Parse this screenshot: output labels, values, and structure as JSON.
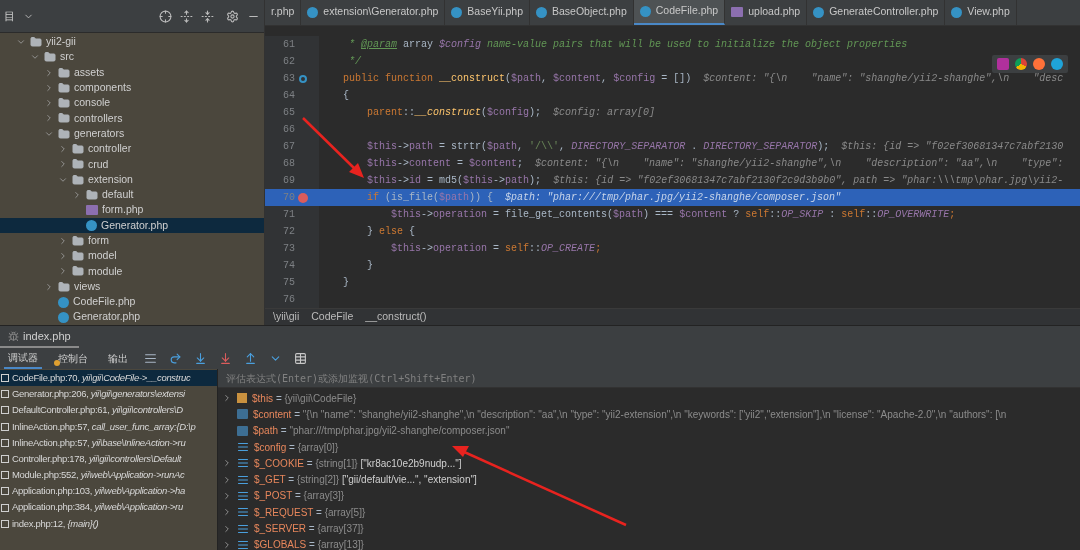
{
  "project": {
    "title": "目",
    "tree": [
      {
        "label": "yii2-gii",
        "kind": "folder",
        "expanded": true,
        "selected": false,
        "children": [
          {
            "label": "src",
            "kind": "folder",
            "expanded": true,
            "selected": false,
            "children": [
              {
                "label": "assets",
                "kind": "folder",
                "expanded": false,
                "selected": false
              },
              {
                "label": "components",
                "kind": "folder",
                "expanded": false,
                "selected": false
              },
              {
                "label": "console",
                "kind": "folder",
                "expanded": false,
                "selected": false
              },
              {
                "label": "controllers",
                "kind": "folder",
                "expanded": false,
                "selected": false
              },
              {
                "label": "generators",
                "kind": "folder",
                "expanded": true,
                "selected": false,
                "children": [
                  {
                    "label": "controller",
                    "kind": "folder",
                    "expanded": false,
                    "selected": false
                  },
                  {
                    "label": "crud",
                    "kind": "folder",
                    "expanded": false,
                    "selected": false
                  },
                  {
                    "label": "extension",
                    "kind": "folder",
                    "expanded": true,
                    "selected": false,
                    "children": [
                      {
                        "label": "default",
                        "kind": "folder",
                        "expanded": false,
                        "selected": false
                      },
                      {
                        "label": "form.php",
                        "kind": "php",
                        "selected": false
                      },
                      {
                        "label": "Generator.php",
                        "kind": "class",
                        "selected": true
                      }
                    ]
                  },
                  {
                    "label": "form",
                    "kind": "folder",
                    "expanded": false,
                    "selected": false
                  },
                  {
                    "label": "model",
                    "kind": "folder",
                    "expanded": false,
                    "selected": false
                  },
                  {
                    "label": "module",
                    "kind": "folder",
                    "expanded": false,
                    "selected": false
                  }
                ]
              },
              {
                "label": "views",
                "kind": "folder",
                "expanded": false,
                "selected": false
              },
              {
                "label": "CodeFile.php",
                "kind": "class",
                "selected": false
              },
              {
                "label": "Generator.php",
                "kind": "class",
                "selected": false
              }
            ]
          }
        ]
      }
    ]
  },
  "editor": {
    "tabs": [
      {
        "label": "r.php",
        "kind": "plain",
        "selected": false
      },
      {
        "label": "extension\\Generator.php",
        "kind": "class",
        "selected": false
      },
      {
        "label": "BaseYii.php",
        "kind": "class",
        "selected": false
      },
      {
        "label": "BaseObject.php",
        "kind": "class",
        "selected": false
      },
      {
        "label": "CodeFile.php",
        "kind": "class",
        "selected": true
      },
      {
        "label": "upload.php",
        "kind": "php",
        "selected": false
      },
      {
        "label": "GenerateController.php",
        "kind": "class",
        "selected": false
      },
      {
        "label": "View.php",
        "kind": "class",
        "selected": false
      }
    ],
    "lines": [
      {
        "number": "61",
        "highlighted": false,
        "kind": "plain",
        "tokens": [
          {
            "kind": "doc",
            "text": "     * "
          },
          {
            "kind": "doctag",
            "text": "@param"
          },
          {
            "kind": "plain",
            "text": " array "
          },
          {
            "kind": "docvar",
            "text": "$config"
          },
          {
            "kind": "doc",
            "text": " name-value pairs that will be used to initialize the object properties"
          }
        ]
      },
      {
        "number": "62",
        "highlighted": false,
        "kind": "plain",
        "tokens": [
          {
            "kind": "doc",
            "text": "     */"
          }
        ]
      },
      {
        "number": "63",
        "highlighted": false,
        "kind": "override",
        "tokens": [
          {
            "kind": "kw",
            "text": "    public function "
          },
          {
            "kind": "fn",
            "text": "__construct"
          },
          {
            "kind": "plain",
            "text": "("
          },
          {
            "kind": "var",
            "text": "$path"
          },
          {
            "kind": "plain",
            "text": ", "
          },
          {
            "kind": "var",
            "text": "$content"
          },
          {
            "kind": "plain",
            "text": ", "
          },
          {
            "kind": "var",
            "text": "$config"
          },
          {
            "kind": "plain",
            "text": " = [])  "
          },
          {
            "kind": "hint",
            "text": "$content: \"{\\n    \"name\": \"shanghe/yii2-shanghe\",\\n    \"desc"
          }
        ]
      },
      {
        "number": "64",
        "highlighted": false,
        "kind": "plain",
        "tokens": [
          {
            "kind": "plain",
            "text": "    {"
          }
        ]
      },
      {
        "number": "65",
        "highlighted": false,
        "kind": "plain",
        "tokens": [
          {
            "kind": "kw",
            "text": "        parent"
          },
          {
            "kind": "plain",
            "text": "::"
          },
          {
            "kind": "fnitalic",
            "text": "__construct"
          },
          {
            "kind": "plain",
            "text": "("
          },
          {
            "kind": "var",
            "text": "$config"
          },
          {
            "kind": "plain",
            "text": ");  "
          },
          {
            "kind": "hint",
            "text": "$config: array[0]"
          }
        ]
      },
      {
        "number": "66",
        "highlighted": false,
        "kind": "plain"
      },
      {
        "number": "67",
        "highlighted": false,
        "kind": "plain",
        "tokens": [
          {
            "kind": "var",
            "text": "        $this"
          },
          {
            "kind": "plain",
            "text": "->"
          },
          {
            "kind": "var",
            "text": "path"
          },
          {
            "kind": "plain",
            "text": " = strtr("
          },
          {
            "kind": "var",
            "text": "$path"
          },
          {
            "kind": "plain",
            "text": ", "
          },
          {
            "kind": "str",
            "text": "'/\\\\'"
          },
          {
            "kind": "plain",
            "text": ", "
          },
          {
            "kind": "const",
            "text": "DIRECTORY_SEPARATOR"
          },
          {
            "kind": "plain",
            "text": " . "
          },
          {
            "kind": "const",
            "text": "DIRECTORY_SEPARATOR"
          },
          {
            "kind": "plain",
            "text": ");  "
          },
          {
            "kind": "hint",
            "text": "$this: {id => \"f02ef30681347c7abf2130"
          }
        ]
      },
      {
        "number": "68",
        "highlighted": false,
        "kind": "plain",
        "tokens": [
          {
            "kind": "var",
            "text": "        $this"
          },
          {
            "kind": "plain",
            "text": "->"
          },
          {
            "kind": "var",
            "text": "content"
          },
          {
            "kind": "plain",
            "text": " = "
          },
          {
            "kind": "var",
            "text": "$content"
          },
          {
            "kind": "plain",
            "text": ";  "
          },
          {
            "kind": "hint",
            "text": "$content: \"{\\n    \"name\": \"shanghe/yii2-shanghe\",\\n    \"description\": \"aa\",\\n    \"type\":"
          }
        ]
      },
      {
        "number": "69",
        "highlighted": false,
        "kind": "plain",
        "tokens": [
          {
            "kind": "var",
            "text": "        $this"
          },
          {
            "kind": "plain",
            "text": "->"
          },
          {
            "kind": "var",
            "text": "id"
          },
          {
            "kind": "plain",
            "text": " = md5("
          },
          {
            "kind": "var",
            "text": "$this"
          },
          {
            "kind": "plain",
            "text": "->"
          },
          {
            "kind": "var",
            "text": "path"
          },
          {
            "kind": "plain",
            "text": ");  "
          },
          {
            "kind": "hint",
            "text": "$this: {id => \"f02ef30681347c7abf2130f2c9d3b9b0\", path => \"phar:\\\\\\tmp\\phar.jpg\\yii2-"
          }
        ]
      },
      {
        "number": "70",
        "highlighted": true,
        "kind": "breakpoint",
        "tokens": [
          {
            "kind": "kw",
            "text": "        if "
          },
          {
            "kind": "plain",
            "text": "(is_file("
          },
          {
            "kind": "var",
            "text": "$path"
          },
          {
            "kind": "plain",
            "text": ")) {  "
          },
          {
            "kind": "hint",
            "text": "$path: \"phar:///tmp/phar.jpg/yii2-shanghe/composer.json\""
          }
        ]
      },
      {
        "number": "71",
        "highlighted": false,
        "kind": "plain",
        "tokens": [
          {
            "kind": "var",
            "text": "            $this"
          },
          {
            "kind": "plain",
            "text": "->"
          },
          {
            "kind": "var",
            "text": "operation"
          },
          {
            "kind": "plain",
            "text": " = file_get_contents("
          },
          {
            "kind": "var",
            "text": "$path"
          },
          {
            "kind": "plain",
            "text": ") === "
          },
          {
            "kind": "var",
            "text": "$content"
          },
          {
            "kind": "plain",
            "text": " ? "
          },
          {
            "kind": "kw",
            "text": "self"
          },
          {
            "kind": "plain",
            "text": "::"
          },
          {
            "kind": "const",
            "text": "OP_SKIP"
          },
          {
            "kind": "plain",
            "text": " : "
          },
          {
            "kind": "kw",
            "text": "self"
          },
          {
            "kind": "plain",
            "text": "::"
          },
          {
            "kind": "const",
            "text": "OP_OVERWRITE"
          },
          {
            "kind": "kw",
            "text": ";"
          }
        ]
      },
      {
        "number": "72",
        "highlighted": false,
        "kind": "plain",
        "tokens": [
          {
            "kind": "plain",
            "text": "        } "
          },
          {
            "kind": "kw",
            "text": "else"
          },
          {
            "kind": "plain",
            "text": " {"
          }
        ]
      },
      {
        "number": "73",
        "highlighted": false,
        "kind": "plain",
        "tokens": [
          {
            "kind": "var",
            "text": "            $this"
          },
          {
            "kind": "plain",
            "text": "->"
          },
          {
            "kind": "var",
            "text": "operation"
          },
          {
            "kind": "plain",
            "text": " = "
          },
          {
            "kind": "kw",
            "text": "self"
          },
          {
            "kind": "plain",
            "text": "::"
          },
          {
            "kind": "const",
            "text": "OP_CREATE"
          },
          {
            "kind": "kw",
            "text": ";"
          }
        ]
      },
      {
        "number": "74",
        "highlighted": false,
        "kind": "plain",
        "tokens": [
          {
            "kind": "plain",
            "text": "        }"
          }
        ]
      },
      {
        "number": "75",
        "highlighted": false,
        "kind": "plain",
        "tokens": [
          {
            "kind": "plain",
            "text": "    }"
          }
        ]
      },
      {
        "number": "76",
        "highlighted": false,
        "kind": "plain"
      }
    ],
    "breadcrumb": [
      "\\yii\\gii",
      "CodeFile",
      "__construct()"
    ]
  },
  "debug": {
    "tab": "index.php",
    "toolbar_tabs": [
      {
        "label": "调试器",
        "selected": true,
        "warning": false
      },
      {
        "label": "控制台",
        "selected": false,
        "warning": true
      },
      {
        "label": "输出",
        "selected": false,
        "warning": false
      }
    ],
    "frames": [
      {
        "location": "CodeFile.php:70,",
        "detail": "yii\\gii\\CodeFile->__construc",
        "selected": true
      },
      {
        "location": "Generator.php:206,",
        "detail": "yii\\gii\\generators\\extensi",
        "selected": false
      },
      {
        "location": "DefaultController.php:61,",
        "detail": "yii\\gii\\controllers\\D",
        "selected": false
      },
      {
        "location": "InlineAction.php:57,",
        "detail": "call_user_func_array:{D:\\p",
        "selected": false
      },
      {
        "location": "InlineAction.php:57,",
        "detail": "yii\\base\\InlineAction->ru",
        "selected": false
      },
      {
        "location": "Controller.php:178,",
        "detail": "yii\\gii\\controllers\\Default",
        "selected": false
      },
      {
        "location": "Module.php:552,",
        "detail": "yii\\web\\Application->runAc",
        "selected": false
      },
      {
        "location": "Application.php:103,",
        "detail": "yii\\web\\Application->ha",
        "selected": false
      },
      {
        "location": "Application.php:384,",
        "detail": "yii\\web\\Application->ru",
        "selected": false
      },
      {
        "location": "index.php:12,",
        "detail": "{main}()",
        "selected": false
      }
    ],
    "evaluate": {
      "placeholder": "评估表达式(Enter)或添加监视(Ctrl+Shift+Enter)"
    },
    "variables": [
      {
        "name": "$this",
        "kind": "object",
        "expandable": true,
        "op": "=",
        "value": "{yii\\gii\\CodeFile}"
      },
      {
        "name": "$content",
        "kind": "string",
        "expandable": false,
        "op": "=",
        "value": "\"{\\n    \"name\": \"shanghe/yii2-shanghe\",\\n    \"description\": \"aa\",\\n    \"type\": \"yii2-extension\",\\n    \"keywords\": [\"yii2\",\"extension\"],\\n    \"license\": \"Apache-2.0\",\\n    \"authors\": [\\n"
      },
      {
        "name": "$path",
        "kind": "string",
        "expandable": false,
        "op": "=",
        "value": "\"phar:///tmp/phar.jpg/yii2-shanghe/composer.json\""
      },
      {
        "name": "$config",
        "kind": "array",
        "expandable": false,
        "op": "=",
        "type": "{array[0]}"
      },
      {
        "name": "$_COOKIE",
        "kind": "array",
        "expandable": true,
        "op": "=",
        "type": "{string[1]}",
        "value": "[\"kr8ac10e2b9nudp...\"]"
      },
      {
        "name": "$_GET",
        "kind": "array",
        "expandable": true,
        "op": "=",
        "type": "{string[2]}",
        "value": "[\"gii/default/vie...\", \"extension\"]"
      },
      {
        "name": "$_POST",
        "kind": "array",
        "expandable": true,
        "op": "=",
        "type": "{array[3]}"
      },
      {
        "name": "$_REQUEST",
        "kind": "array",
        "expandable": true,
        "op": "=",
        "type": "{array[5]}"
      },
      {
        "name": "$_SERVER",
        "kind": "array",
        "expandable": true,
        "op": "=",
        "type": "{array[37]}"
      },
      {
        "name": "$GLOBALS",
        "kind": "array",
        "expandable": true,
        "op": "=",
        "type": "{array[13]}"
      }
    ]
  }
}
